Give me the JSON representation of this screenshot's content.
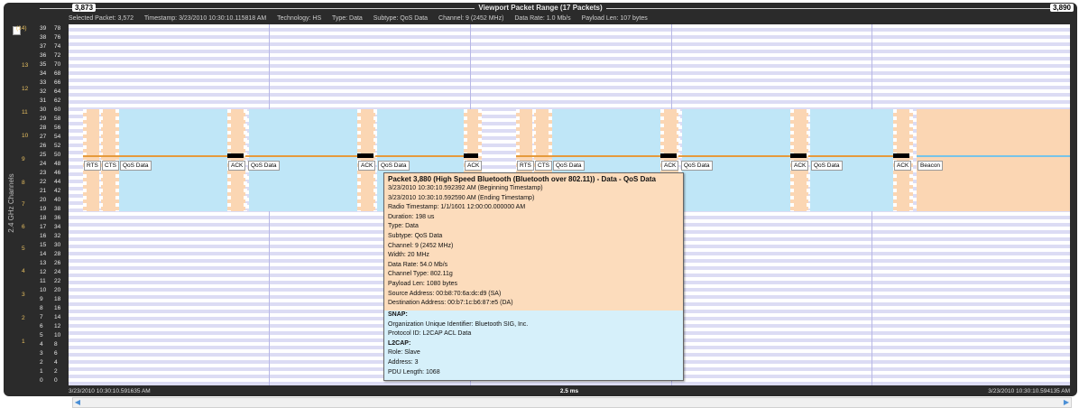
{
  "viewport": {
    "start_packet": "3,873",
    "end_packet": "3,890",
    "title": "Viewport Packet Range (17 Packets)"
  },
  "selected_info": {
    "selected_packet": "Selected Packet: 3,572",
    "timestamp": "Timestamp: 3/23/2010 10:30:10.115818 AM",
    "technology": "Technology: HS",
    "type": "Type: Data",
    "subtype": "Subtype: QoS Data",
    "channel": "Channel: 9 (2452 MHz)",
    "data_rate": "Data Rate: 1.0 Mb/s",
    "payload": "Payload Len: 107 bytes"
  },
  "axis": {
    "label": "2.4 GHz Channels",
    "channel_numbers": [
      "(14)",
      "13",
      "12",
      "11",
      "10",
      "9",
      "8",
      "7",
      "6",
      "5",
      "4",
      "3",
      "2",
      "1"
    ],
    "left_col": [
      "39",
      "38",
      "37",
      "36",
      "35",
      "34",
      "33",
      "32",
      "31",
      "30",
      "29",
      "28",
      "27",
      "26",
      "25",
      "24",
      "23",
      "22",
      "21",
      "20",
      "19",
      "18",
      "17",
      "16",
      "15",
      "14",
      "13",
      "12",
      "11",
      "10",
      "9",
      "8",
      "7",
      "6",
      "5",
      "4",
      "3",
      "2",
      "1",
      "0"
    ],
    "right_col": [
      "78",
      "76",
      "74",
      "72",
      "70",
      "68",
      "66",
      "64",
      "62",
      "60",
      "58",
      "56",
      "54",
      "52",
      "50",
      "48",
      "46",
      "44",
      "42",
      "40",
      "38",
      "36",
      "34",
      "32",
      "30",
      "28",
      "26",
      "24",
      "22",
      "20",
      "18",
      "16",
      "14",
      "12",
      "10",
      "8",
      "6",
      "4",
      "2",
      "0"
    ]
  },
  "packets": [
    {
      "label": "RTS"
    },
    {
      "label": "CTS"
    },
    {
      "label": "QoS Data"
    },
    {
      "label": "ACK"
    },
    {
      "label": "QoS Data"
    },
    {
      "label": "ACK"
    },
    {
      "label": "QoS Data"
    },
    {
      "label": "ACK"
    },
    {
      "label": "RTS"
    },
    {
      "label": "CTS"
    },
    {
      "label": "QoS Data"
    },
    {
      "label": "ACK"
    },
    {
      "label": "QoS Data"
    },
    {
      "label": "ACK"
    },
    {
      "label": "QoS Data"
    },
    {
      "label": "ACK"
    },
    {
      "label": "Beacon"
    }
  ],
  "popup": {
    "title": "Packet 3,880 (High Speed Bluetooth (Bluetooth over 802.11)) - Data - QoS Data",
    "lines": [
      "3/23/2010 10:30:10.592392 AM (Beginning Timestamp)",
      "3/23/2010 10:30:10.592590 AM (Ending Timestamp)",
      "Radio Timestamp: 1/1/1601 12:00:00.000000 AM",
      "Duration: 198 us",
      "Type: Data",
      "Subtype: QoS Data",
      "Channel: 9 (2452 MHz)",
      "Width: 20 MHz",
      "Data Rate: 54.0 Mb/s",
      "Channel Type: 802.11g",
      "Payload Len: 1080 bytes",
      "Source Address: 00:b8:70:6a:dc:d9 (SA)",
      "Destination Address: 00:b7:1c:b6:87:e5 (DA)"
    ],
    "snap_title": "SNAP:",
    "snap_lines": [
      "Organization Unique Identifier: Bluetooth SIG, Inc.",
      "Protocol ID: L2CAP ACL Data"
    ],
    "l2cap_title": "L2CAP:",
    "l2cap_lines": [
      "Role: Slave",
      "Address: 3",
      "PDU Length: 1068"
    ]
  },
  "bottom": {
    "start_time": "3/23/2010 10:30:10.591635 AM",
    "span": "2.5 ms",
    "end_time": "3/23/2010 10:30:10.594135 AM"
  },
  "colors": {
    "frame": "#2b2b2b",
    "data_band": "#bfe6f7",
    "control_band": "#fbd6b3",
    "packet_line": "#e69a3c"
  }
}
